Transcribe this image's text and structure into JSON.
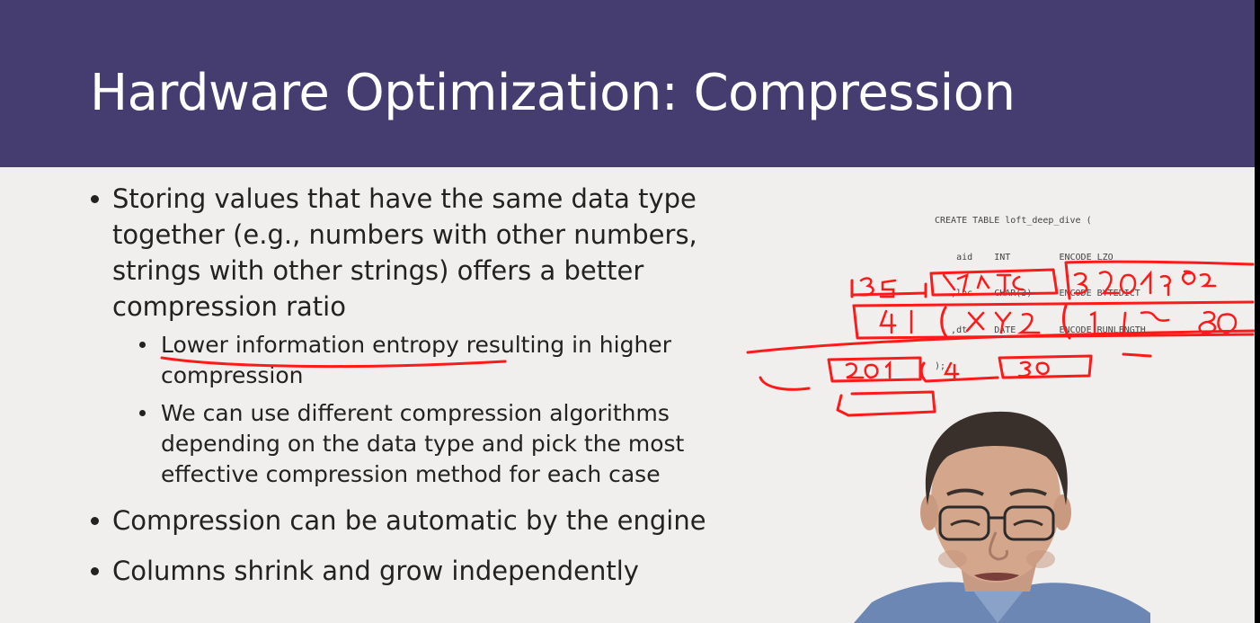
{
  "slide": {
    "title": "Hardware Optimization: Compression",
    "bullets": {
      "b1_l1": "Storing values that have the same data type",
      "b1_l2": "together (e.g., numbers with other numbers,",
      "b1_l3": "strings with other strings) offers a better",
      "b1_l4": "compression ratio",
      "sub1_l1": "Lower information entropy resulting in higher",
      "sub1_l2": "compression",
      "sub2_l1": "We can use different compression algorithms",
      "sub2_l2": "depending on the data type and pick the most",
      "sub2_l3": "effective compression method for each case",
      "b2": "Compression can be automatic by the engine",
      "b3": "Columns shrink and grow independently"
    },
    "code": {
      "l1": "CREATE TABLE loft_deep_dive (",
      "l2": "    aid    INT         ENCODE LZO",
      "l3": "   ,loc    CHAR(3)     ENCODE BYTEDICT",
      "l4": "   ,dt     DATE        ENCODE RUNLENGTH",
      "l5": ");"
    },
    "colors": {
      "title_bar": "#453c70",
      "ink": "#ff1a1a",
      "background": "#f0efee"
    }
  }
}
